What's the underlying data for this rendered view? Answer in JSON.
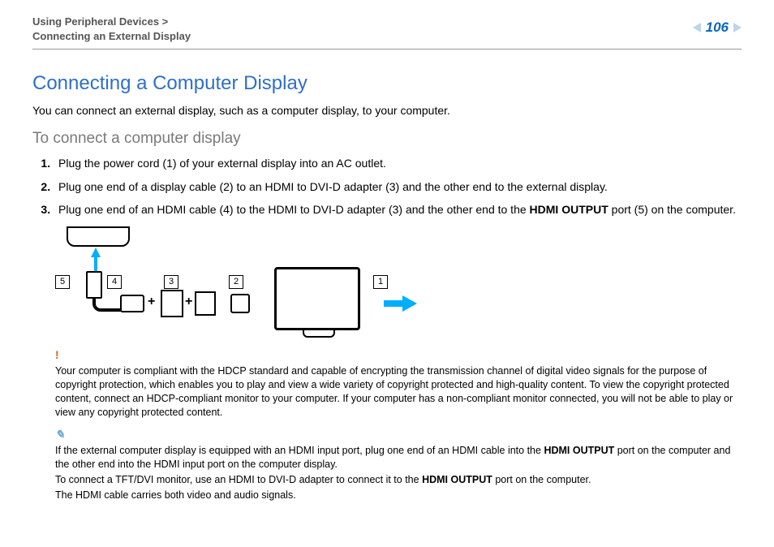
{
  "header": {
    "path_top": "Using Peripheral Devices >",
    "path_bottom": "Connecting an External Display",
    "page_number": "106"
  },
  "title": "Connecting a Computer Display",
  "intro": "You can connect an external display, such as a computer display, to your computer.",
  "subtitle": "To connect a computer display",
  "steps": [
    "Plug the power cord (1) of your external display into an AC outlet.",
    "Plug one end of a display cable (2) to an HDMI to DVI-D adapter (3) and the other end to the external display.",
    "Plug one end of an HDMI cable (4) to the HDMI to DVI-D adapter (3) and the other end to the"
  ],
  "step3_bold": "HDMI OUTPUT",
  "step3_tail": " port (5) on the computer.",
  "labels": {
    "l1": "1",
    "l2": "2",
    "l3": "3",
    "l4": "4",
    "l5": "5"
  },
  "note1_mark": "!",
  "note1": "Your computer is compliant with the HDCP standard and capable of encrypting the transmission channel of digital video signals for the purpose of copyright protection, which enables you to play and view a wide variety of copyright protected and high-quality content. To view the copyright protected content, connect an HDCP-compliant monitor to your computer. If your computer has a non-compliant monitor connected, you will not be able to play or view any copyright protected content.",
  "note2_mark": "✎",
  "note2_a": "If the external computer display is equipped with an HDMI input port, plug one end of an HDMI cable into the ",
  "note2_bold": "HDMI OUTPUT",
  "note2_b": " port on the computer and the other end into the HDMI input port on the computer display.",
  "note3_a": "To connect a TFT/DVI monitor, use an HDMI to DVI-D adapter to connect it to the ",
  "note3_bold": "HDMI OUTPUT",
  "note3_b": " port on the computer.",
  "note4": "The HDMI cable carries both video and audio signals."
}
